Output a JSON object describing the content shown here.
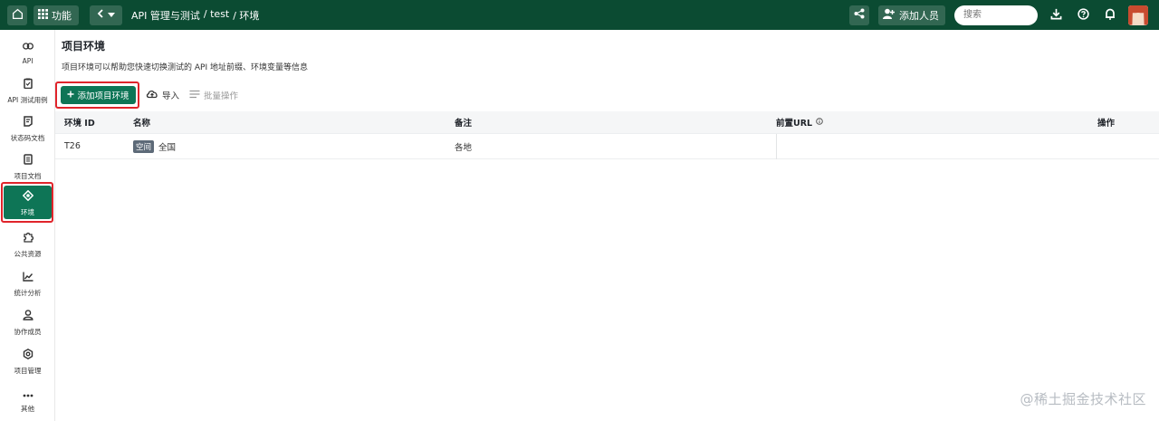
{
  "topbar": {
    "func_label": "功能",
    "breadcrumb": [
      "API 管理与测试",
      "/ test",
      "/ 环境"
    ],
    "add_member_label": "添加人员",
    "search_placeholder": "搜索"
  },
  "sidebar": {
    "items": [
      {
        "label": "API",
        "icon": "link-icon"
      },
      {
        "label": "API 测试用例",
        "icon": "clipboard-icon"
      },
      {
        "label": "状态码文档",
        "icon": "doc-icon"
      },
      {
        "label": "项目文档",
        "icon": "book-icon"
      },
      {
        "label": "环境",
        "icon": "environment-icon"
      },
      {
        "label": "公共资源",
        "icon": "puzzle-icon"
      },
      {
        "label": "统计分析",
        "icon": "chart-icon"
      },
      {
        "label": "协作成员",
        "icon": "members-icon"
      },
      {
        "label": "项目管理",
        "icon": "settings-icon"
      },
      {
        "label": "其他",
        "icon": "more-icon"
      }
    ],
    "active_index": 4
  },
  "main": {
    "title": "项目环境",
    "description": "项目环境可以帮助您快速切换测试的 API 地址前缀、环境变量等信息",
    "add_button": "添加项目环境",
    "import_button": "导入",
    "batch_button": "批量操作"
  },
  "table": {
    "headers": {
      "id": "环境 ID",
      "name": "名称",
      "note": "备注",
      "url": "前置URL",
      "op": "操作"
    },
    "rows": [
      {
        "id": "T26",
        "tag": "空间",
        "name": "全国",
        "note": "各地",
        "url": "",
        "op": ""
      }
    ]
  },
  "watermark": "@稀土掘金技术社区",
  "colors": {
    "topbar": "#0b4b32",
    "accent": "#0e7556",
    "highlight": "#e0242b"
  }
}
